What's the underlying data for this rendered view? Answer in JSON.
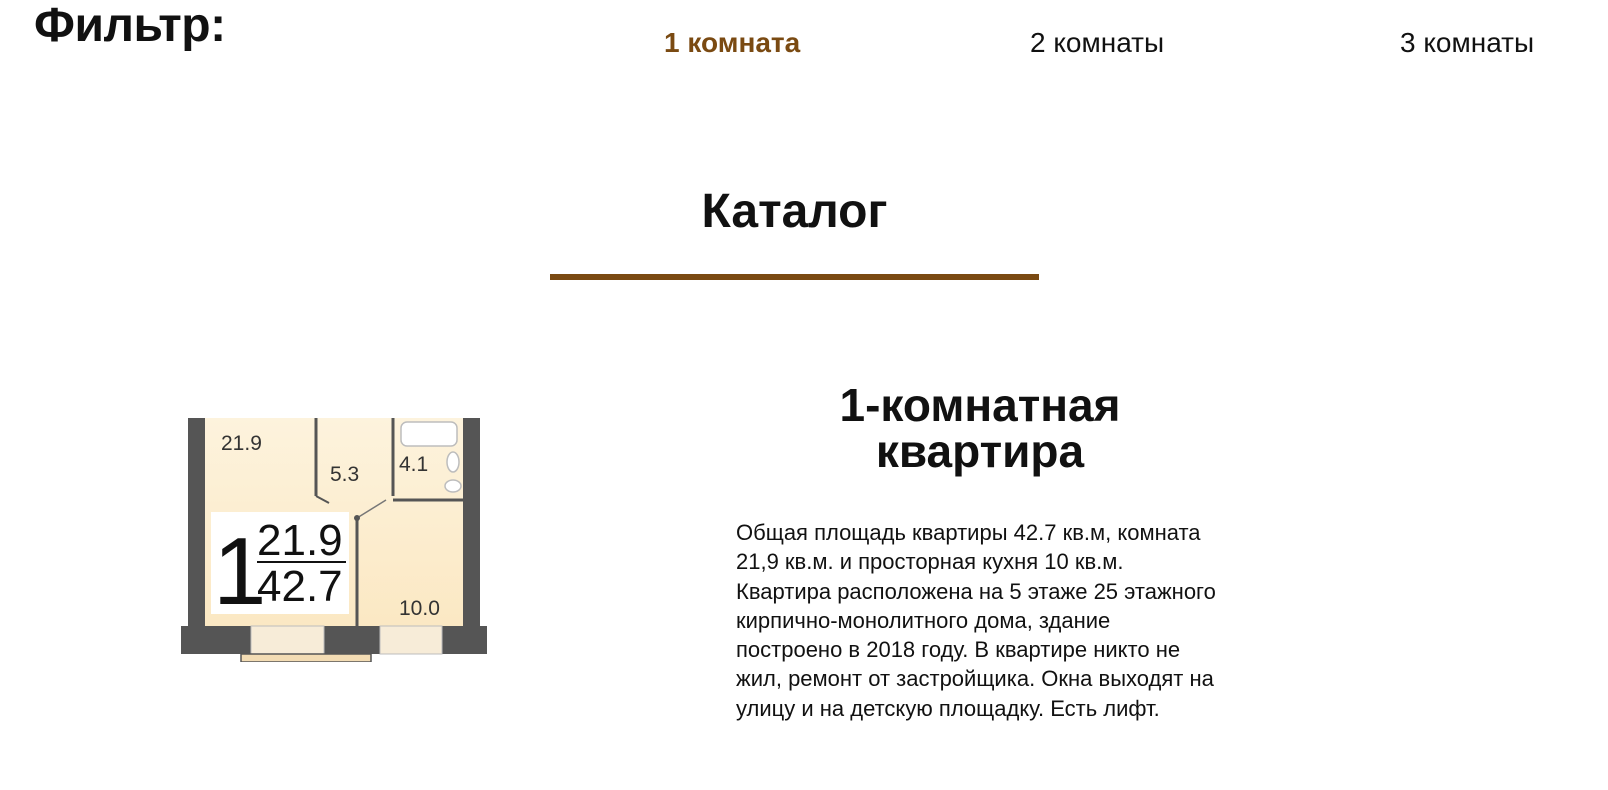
{
  "filter": {
    "title": "Фильтр:",
    "options": [
      {
        "label": "1 комната",
        "active": true
      },
      {
        "label": "2 комнаты",
        "active": false
      },
      {
        "label": "3 комнаты",
        "active": false
      }
    ]
  },
  "catalog": {
    "title": "Каталог",
    "accent_color": "#7a4a12"
  },
  "apartment": {
    "plan": {
      "rooms_count": "1",
      "living_area": "21.9",
      "total_area": "42.7",
      "room_labels": {
        "living": "21.9",
        "hall": "5.3",
        "bath": "4.1",
        "kitchen": "10.0"
      }
    },
    "title_line1": "1-комнатная",
    "title_line2": "квартира",
    "description_lines": [
      "Общая площадь квартиры 42.7 кв.м, комната",
      "21,9 кв.м. и просторная кухня 10 кв.м.",
      "Квартира расположена на 5 этаже 25 этажного",
      "кирпично-монолитного дома, здание",
      "построено в 2018 году. В квартире никто не",
      "жил, ремонт от застройщика. Окна выходят на",
      "улицу и на детскую площадку. Есть лифт."
    ]
  }
}
